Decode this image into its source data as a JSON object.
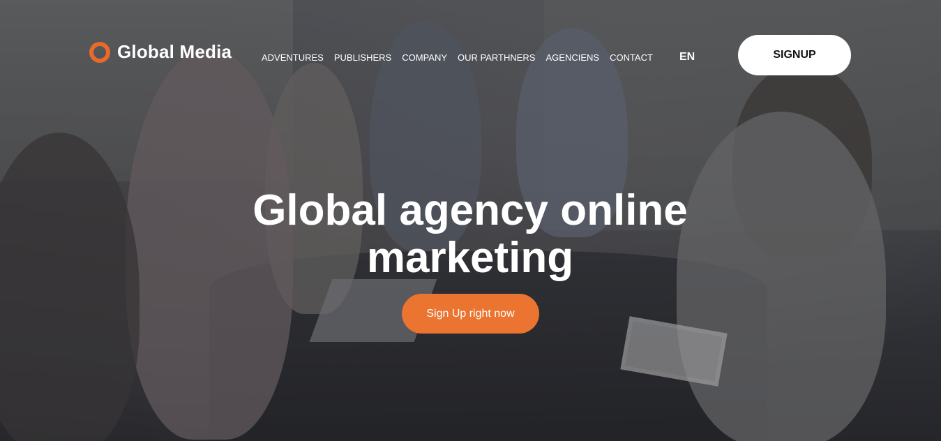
{
  "brand": {
    "name": "Global Media",
    "accent_color": "#ea6a2a",
    "logo_icon": "ring-logo-icon"
  },
  "nav": {
    "items": [
      {
        "label": "ADVENTURES"
      },
      {
        "label": "PUBLISHERS"
      },
      {
        "label": "COMPANY"
      },
      {
        "label": "OUR PARTHNERS"
      },
      {
        "label": "AGENCIENS"
      },
      {
        "label": "CONTACT"
      }
    ],
    "language": "EN",
    "signup_label": "SIGNUP"
  },
  "hero": {
    "title": "Global agency online marketing",
    "cta_label": "Sign Up right now",
    "cta_color": "#ea7430"
  }
}
